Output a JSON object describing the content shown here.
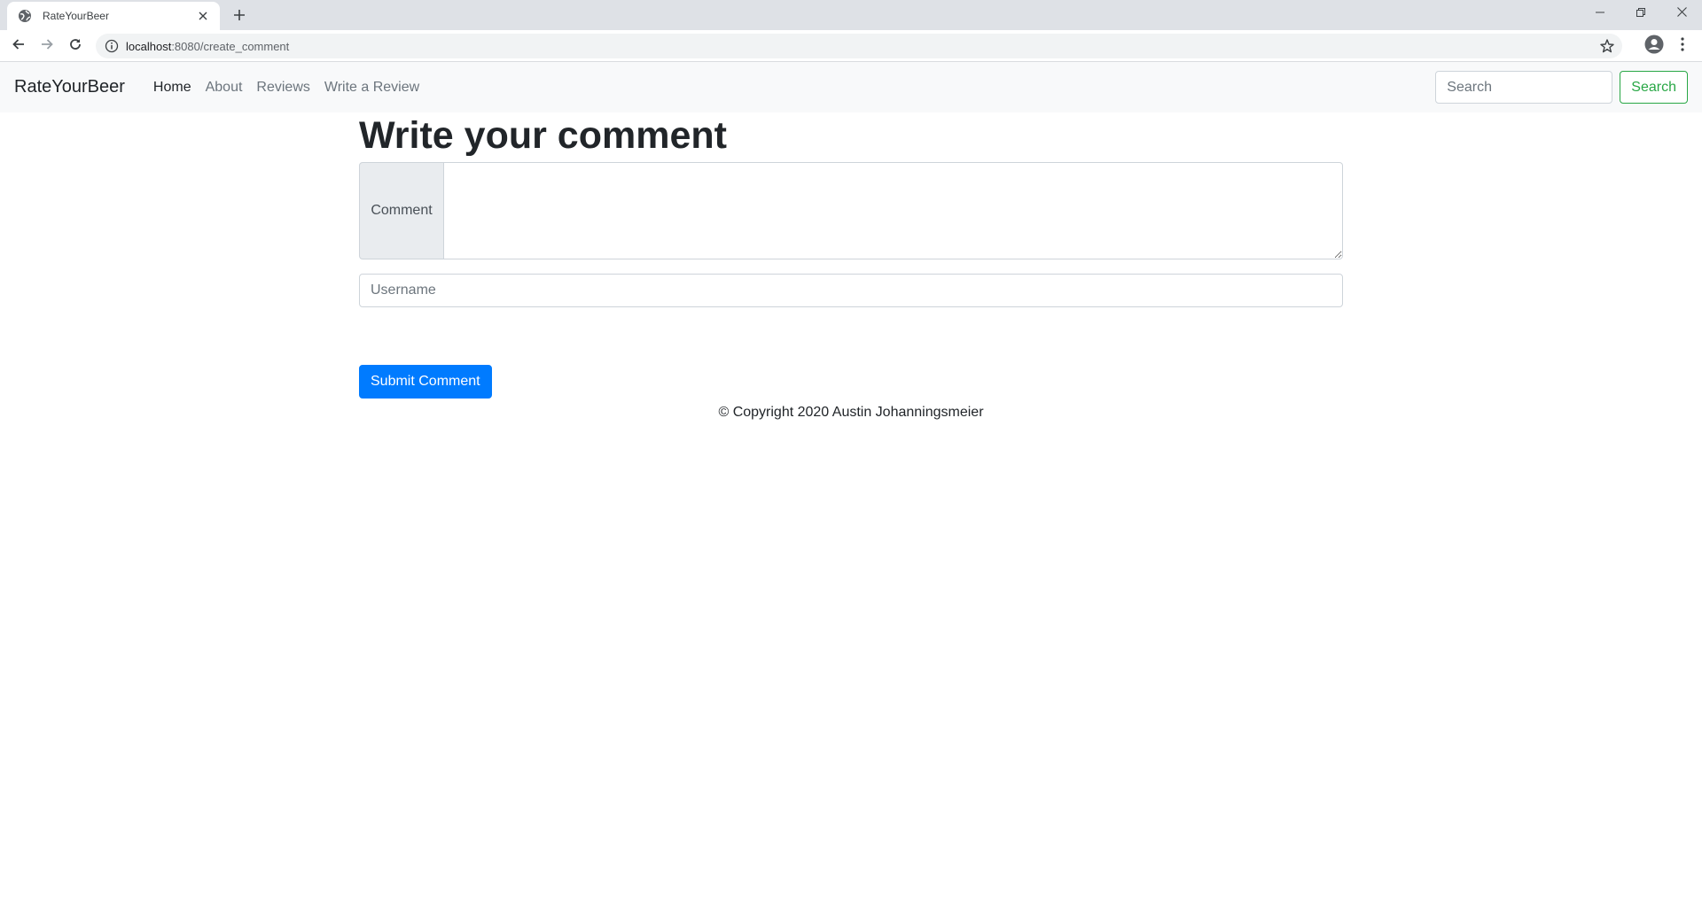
{
  "browser": {
    "tab_title": "RateYourBeer",
    "url_host": "localhost",
    "url_rest": ":8080/create_comment"
  },
  "icons": {
    "favicon": "globe-icon",
    "tab_close": "close-icon",
    "new_tab": "plus-icon",
    "back": "arrow-left-icon",
    "forward": "arrow-right-icon",
    "reload": "reload-icon",
    "site_info": "info-icon",
    "bookmark": "star-icon",
    "profile": "account-icon",
    "menu": "kebab-menu-icon",
    "minimize": "minimize-icon",
    "maximize": "restore-icon",
    "close_window": "close-icon"
  },
  "navbar": {
    "brand": "RateYourBeer",
    "links": [
      {
        "label": "Home",
        "active": true
      },
      {
        "label": "About",
        "active": false
      },
      {
        "label": "Reviews",
        "active": false
      },
      {
        "label": "Write a Review",
        "active": false
      }
    ],
    "search_placeholder": "Search",
    "search_button": "Search"
  },
  "form": {
    "title": "Write your comment",
    "comment_label": "Comment",
    "comment_value": "",
    "username_placeholder": "Username",
    "username_value": "",
    "submit_label": "Submit Comment"
  },
  "footer": {
    "text": "© Copyright 2020 Austin Johanningsmeier"
  },
  "colors": {
    "primary": "#007bff",
    "success": "#28a745",
    "navbar_bg": "#f8f9fa",
    "addon_bg": "#e9ecef"
  }
}
